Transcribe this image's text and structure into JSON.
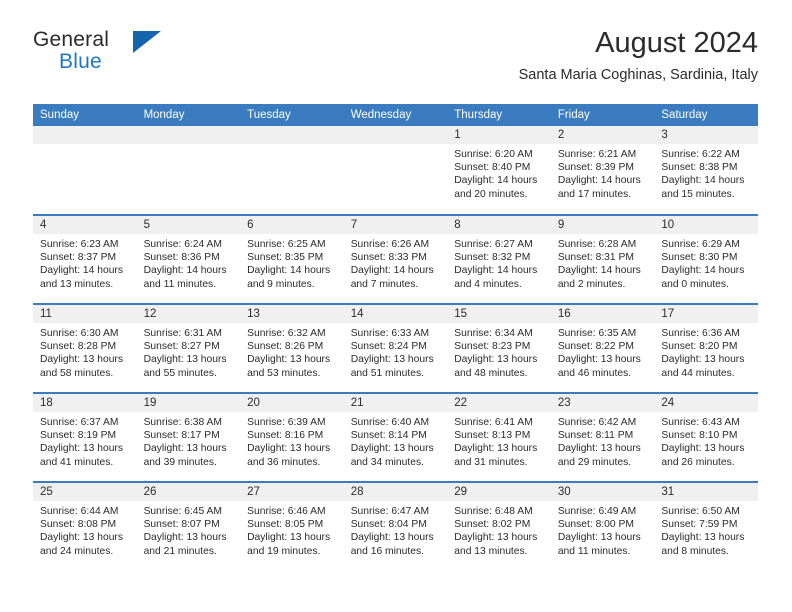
{
  "brand": {
    "line1": "General",
    "line2": "Blue",
    "triangle_icon": "brand-triangle-icon",
    "accent_color": "#1565ad",
    "blue_text_color": "#1f77c2"
  },
  "header": {
    "title": "August 2024",
    "subtitle": "Santa Maria Coghinas, Sardinia, Italy"
  },
  "theme": {
    "header_bar": "#3a7cbf",
    "daynum_strip": "#f0f0f0",
    "text": "#2b2b2b"
  },
  "weekday_headers": [
    "Sunday",
    "Monday",
    "Tuesday",
    "Wednesday",
    "Thursday",
    "Friday",
    "Saturday"
  ],
  "labels": {
    "sunrise_prefix": "Sunrise:",
    "sunset_prefix": "Sunset:",
    "daylight_prefix": "Daylight:"
  },
  "weeks": [
    [
      {
        "day": "",
        "empty": true
      },
      {
        "day": "",
        "empty": true
      },
      {
        "day": "",
        "empty": true
      },
      {
        "day": "",
        "empty": true
      },
      {
        "day": "1",
        "sunrise": "Sunrise: 6:20 AM",
        "sunset": "Sunset: 8:40 PM",
        "daylight": "Daylight: 14 hours and 20 minutes."
      },
      {
        "day": "2",
        "sunrise": "Sunrise: 6:21 AM",
        "sunset": "Sunset: 8:39 PM",
        "daylight": "Daylight: 14 hours and 17 minutes."
      },
      {
        "day": "3",
        "sunrise": "Sunrise: 6:22 AM",
        "sunset": "Sunset: 8:38 PM",
        "daylight": "Daylight: 14 hours and 15 minutes."
      }
    ],
    [
      {
        "day": "4",
        "sunrise": "Sunrise: 6:23 AM",
        "sunset": "Sunset: 8:37 PM",
        "daylight": "Daylight: 14 hours and 13 minutes."
      },
      {
        "day": "5",
        "sunrise": "Sunrise: 6:24 AM",
        "sunset": "Sunset: 8:36 PM",
        "daylight": "Daylight: 14 hours and 11 minutes."
      },
      {
        "day": "6",
        "sunrise": "Sunrise: 6:25 AM",
        "sunset": "Sunset: 8:35 PM",
        "daylight": "Daylight: 14 hours and 9 minutes."
      },
      {
        "day": "7",
        "sunrise": "Sunrise: 6:26 AM",
        "sunset": "Sunset: 8:33 PM",
        "daylight": "Daylight: 14 hours and 7 minutes."
      },
      {
        "day": "8",
        "sunrise": "Sunrise: 6:27 AM",
        "sunset": "Sunset: 8:32 PM",
        "daylight": "Daylight: 14 hours and 4 minutes."
      },
      {
        "day": "9",
        "sunrise": "Sunrise: 6:28 AM",
        "sunset": "Sunset: 8:31 PM",
        "daylight": "Daylight: 14 hours and 2 minutes."
      },
      {
        "day": "10",
        "sunrise": "Sunrise: 6:29 AM",
        "sunset": "Sunset: 8:30 PM",
        "daylight": "Daylight: 14 hours and 0 minutes."
      }
    ],
    [
      {
        "day": "11",
        "sunrise": "Sunrise: 6:30 AM",
        "sunset": "Sunset: 8:28 PM",
        "daylight": "Daylight: 13 hours and 58 minutes."
      },
      {
        "day": "12",
        "sunrise": "Sunrise: 6:31 AM",
        "sunset": "Sunset: 8:27 PM",
        "daylight": "Daylight: 13 hours and 55 minutes."
      },
      {
        "day": "13",
        "sunrise": "Sunrise: 6:32 AM",
        "sunset": "Sunset: 8:26 PM",
        "daylight": "Daylight: 13 hours and 53 minutes."
      },
      {
        "day": "14",
        "sunrise": "Sunrise: 6:33 AM",
        "sunset": "Sunset: 8:24 PM",
        "daylight": "Daylight: 13 hours and 51 minutes."
      },
      {
        "day": "15",
        "sunrise": "Sunrise: 6:34 AM",
        "sunset": "Sunset: 8:23 PM",
        "daylight": "Daylight: 13 hours and 48 minutes."
      },
      {
        "day": "16",
        "sunrise": "Sunrise: 6:35 AM",
        "sunset": "Sunset: 8:22 PM",
        "daylight": "Daylight: 13 hours and 46 minutes."
      },
      {
        "day": "17",
        "sunrise": "Sunrise: 6:36 AM",
        "sunset": "Sunset: 8:20 PM",
        "daylight": "Daylight: 13 hours and 44 minutes."
      }
    ],
    [
      {
        "day": "18",
        "sunrise": "Sunrise: 6:37 AM",
        "sunset": "Sunset: 8:19 PM",
        "daylight": "Daylight: 13 hours and 41 minutes."
      },
      {
        "day": "19",
        "sunrise": "Sunrise: 6:38 AM",
        "sunset": "Sunset: 8:17 PM",
        "daylight": "Daylight: 13 hours and 39 minutes."
      },
      {
        "day": "20",
        "sunrise": "Sunrise: 6:39 AM",
        "sunset": "Sunset: 8:16 PM",
        "daylight": "Daylight: 13 hours and 36 minutes."
      },
      {
        "day": "21",
        "sunrise": "Sunrise: 6:40 AM",
        "sunset": "Sunset: 8:14 PM",
        "daylight": "Daylight: 13 hours and 34 minutes."
      },
      {
        "day": "22",
        "sunrise": "Sunrise: 6:41 AM",
        "sunset": "Sunset: 8:13 PM",
        "daylight": "Daylight: 13 hours and 31 minutes."
      },
      {
        "day": "23",
        "sunrise": "Sunrise: 6:42 AM",
        "sunset": "Sunset: 8:11 PM",
        "daylight": "Daylight: 13 hours and 29 minutes."
      },
      {
        "day": "24",
        "sunrise": "Sunrise: 6:43 AM",
        "sunset": "Sunset: 8:10 PM",
        "daylight": "Daylight: 13 hours and 26 minutes."
      }
    ],
    [
      {
        "day": "25",
        "sunrise": "Sunrise: 6:44 AM",
        "sunset": "Sunset: 8:08 PM",
        "daylight": "Daylight: 13 hours and 24 minutes."
      },
      {
        "day": "26",
        "sunrise": "Sunrise: 6:45 AM",
        "sunset": "Sunset: 8:07 PM",
        "daylight": "Daylight: 13 hours and 21 minutes."
      },
      {
        "day": "27",
        "sunrise": "Sunrise: 6:46 AM",
        "sunset": "Sunset: 8:05 PM",
        "daylight": "Daylight: 13 hours and 19 minutes."
      },
      {
        "day": "28",
        "sunrise": "Sunrise: 6:47 AM",
        "sunset": "Sunset: 8:04 PM",
        "daylight": "Daylight: 13 hours and 16 minutes."
      },
      {
        "day": "29",
        "sunrise": "Sunrise: 6:48 AM",
        "sunset": "Sunset: 8:02 PM",
        "daylight": "Daylight: 13 hours and 13 minutes."
      },
      {
        "day": "30",
        "sunrise": "Sunrise: 6:49 AM",
        "sunset": "Sunset: 8:00 PM",
        "daylight": "Daylight: 13 hours and 11 minutes."
      },
      {
        "day": "31",
        "sunrise": "Sunrise: 6:50 AM",
        "sunset": "Sunset: 7:59 PM",
        "daylight": "Daylight: 13 hours and 8 minutes."
      }
    ]
  ]
}
